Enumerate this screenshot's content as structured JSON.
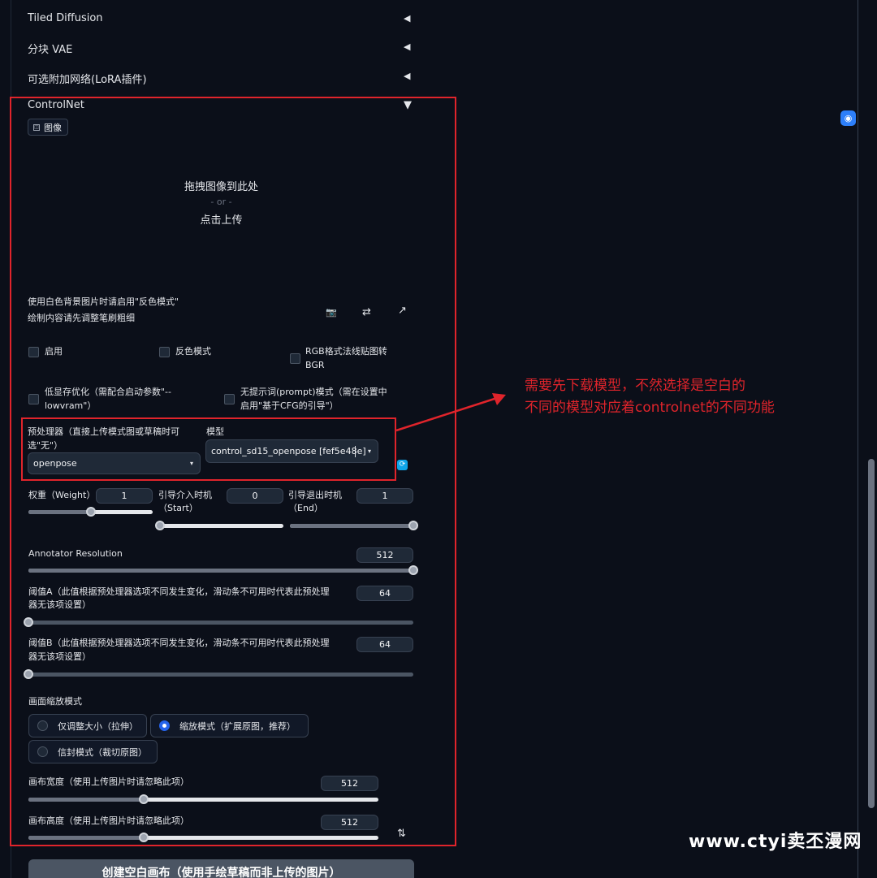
{
  "accordions": [
    {
      "title": "Tiled Diffusion",
      "arrow": "◀"
    },
    {
      "title": "分块 VAE",
      "arrow": "◀"
    },
    {
      "title": "可选附加网络(LoRA插件)",
      "arrow": "◀"
    },
    {
      "title": "ControlNet",
      "arrow": "▼"
    }
  ],
  "image_tab": {
    "label": "图像",
    "icon": "image-icon"
  },
  "dropzone": {
    "line1": "拖拽图像到此处",
    "or": "- or -",
    "line2": "点击上传"
  },
  "hints": {
    "line1": "使用白色背景图片时请启用\"反色模式\"",
    "line2": "绘制内容请先调整笔刷粗细"
  },
  "tool_icons": {
    "camera": "📷",
    "swap": "⇄",
    "arrow": "↗"
  },
  "checkboxes": {
    "enable": "启用",
    "invert": "反色模式",
    "rgb_bgr_1": "RGB格式法线贴图转",
    "rgb_bgr_2": "BGR",
    "lowvram_1": "低显存优化（需配合启动参数\"--",
    "lowvram_2": "lowvram\"）",
    "noprompt_1": "无提示词(prompt)模式（需在设置中",
    "noprompt_2": "启用\"基于CFG的引导\"）"
  },
  "preprocessor": {
    "label_1": "预处理器（直接上传模式图或草稿时可",
    "label_2": "选\"无\"）",
    "value": "openpose",
    "caret": "▾"
  },
  "model": {
    "label": "模型",
    "value": "control_sd15_openpose [fef5e48e]",
    "caret": "▾"
  },
  "weight": {
    "label": "权重（Weight）",
    "value": "1",
    "fraction": 0.5
  },
  "guidance_start": {
    "label_1": "引导介入时机",
    "label_2": "（Start）",
    "value": "0",
    "fraction": 0.0
  },
  "guidance_end": {
    "label_1": "引导退出时机",
    "label_2": "（End）",
    "value": "1",
    "fraction": 1.0
  },
  "annotator_resolution": {
    "label": "Annotator Resolution",
    "value": "512",
    "fraction": 1.0
  },
  "threshold_a": {
    "label_1": "阈值A（此值根据预处理器选项不同发生变化，滑动条不可用时代表此预处理",
    "label_2": "器无该项设置）",
    "value": "64",
    "fraction": 0.0
  },
  "threshold_b": {
    "label_1": "阈值B（此值根据预处理器选项不同发生变化，滑动条不可用时代表此预处理",
    "label_2": "器无该项设置）",
    "value": "64",
    "fraction": 0.0
  },
  "resize_mode": {
    "label": "画面缩放模式",
    "options": [
      "仅调整大小（拉伸）",
      "缩放模式（扩展原图，推荐）",
      "信封模式（裁切原图）"
    ],
    "selected": 1
  },
  "canvas_width": {
    "label": "画布宽度（使用上传图片时请忽略此项）",
    "value": "512",
    "fraction": 0.33
  },
  "canvas_height": {
    "label": "画布高度（使用上传图片时请忽略此项）",
    "value": "512",
    "fraction": 0.33
  },
  "swap_icon": "⇅",
  "create_button": "创建空白画布（使用手绘草稿而非上传的图片）",
  "annotation": {
    "line1": "需要先下载模型，不然选择是空白的",
    "line2": "不同的模型对应着controlnet的不同功能"
  },
  "watermark": "www.ctyi卖丕漫网",
  "colors": {
    "background": "#0b0f19",
    "annotation_red": "#e0242b",
    "radio_selected": "#2563eb"
  }
}
